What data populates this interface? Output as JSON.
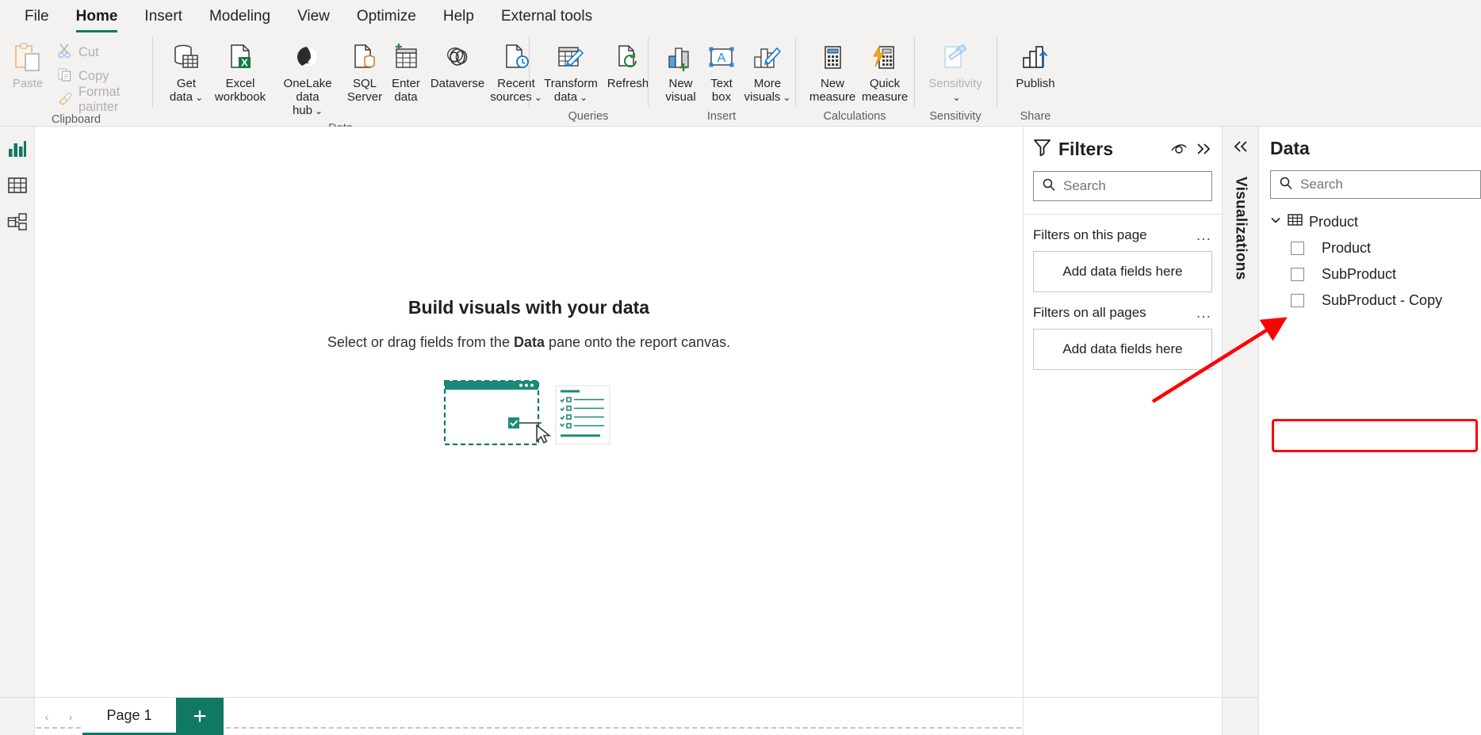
{
  "ribbon": {
    "tabs": [
      {
        "label": "File",
        "active": false
      },
      {
        "label": "Home",
        "active": true
      },
      {
        "label": "Insert",
        "active": false
      },
      {
        "label": "Modeling",
        "active": false
      },
      {
        "label": "View",
        "active": false
      },
      {
        "label": "Optimize",
        "active": false
      },
      {
        "label": "Help",
        "active": false
      },
      {
        "label": "External tools",
        "active": false
      }
    ],
    "groups": {
      "clipboard": {
        "label": "Clipboard",
        "paste": "Paste",
        "cut": "Cut",
        "copy": "Copy",
        "format_painter": "Format painter"
      },
      "data": {
        "label": "Data",
        "get_data": "Get\ndata",
        "excel_workbook": "Excel\nworkbook",
        "onelake": "OneLake data\nhub",
        "sql_server": "SQL\nServer",
        "enter_data": "Enter\ndata",
        "dataverse": "Dataverse",
        "recent_sources": "Recent\nsources"
      },
      "queries": {
        "label": "Queries",
        "transform_data": "Transform\ndata",
        "refresh": "Refresh"
      },
      "insert": {
        "label": "Insert",
        "new_visual": "New\nvisual",
        "text_box": "Text\nbox",
        "more_visuals": "More\nvisuals"
      },
      "calculations": {
        "label": "Calculations",
        "new_measure": "New\nmeasure",
        "quick_measure": "Quick\nmeasure"
      },
      "sensitivity": {
        "label": "Sensitivity",
        "button": "Sensitivity"
      },
      "share": {
        "label": "Share",
        "publish": "Publish"
      }
    }
  },
  "canvas": {
    "title": "Build visuals with your data",
    "subtitle_before": "Select or drag fields from the ",
    "subtitle_bold": "Data",
    "subtitle_after": " pane onto the report canvas."
  },
  "filters": {
    "title": "Filters",
    "search_placeholder": "Search",
    "sections": [
      {
        "title": "Filters on this page",
        "dropzone": "Add data fields here",
        "menu": "…"
      },
      {
        "title": "Filters on all pages",
        "dropzone": "Add data fields here",
        "menu": "…"
      }
    ]
  },
  "visualizations": {
    "title": "Visualizations"
  },
  "data_pane": {
    "title": "Data",
    "search_placeholder": "Search",
    "tables": [
      {
        "name": "Product",
        "expanded": true,
        "fields": [
          {
            "name": "Product",
            "checked": false,
            "highlighted": false
          },
          {
            "name": "SubProduct",
            "checked": false,
            "highlighted": false
          },
          {
            "name": "SubProduct - Copy",
            "checked": false,
            "highlighted": true
          }
        ]
      }
    ]
  },
  "pagebar": {
    "prev": "‹",
    "next": "›",
    "page_label": "Page 1",
    "add_label": "+"
  },
  "colors": {
    "accent_green": "#117865",
    "ribbon_bg": "#f3f2f1",
    "highlight_red": "#ff0000",
    "excel_green": "#107c41",
    "blue": "#0078d4"
  }
}
